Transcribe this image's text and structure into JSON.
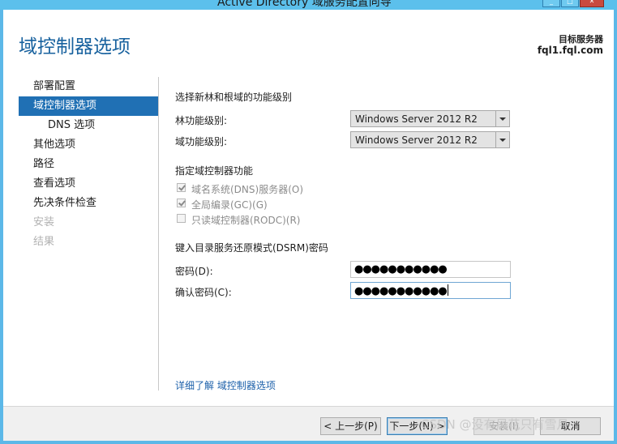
{
  "window": {
    "title": "Active Directory 域服务配置向导",
    "controls": [
      "minimize",
      "maximize",
      "close"
    ]
  },
  "header": {
    "page_title": "域控制器选项",
    "target_label": "目标服务器",
    "target_host": "fql1.fql.com"
  },
  "nav": {
    "items": [
      {
        "label": "部署配置",
        "state": "normal"
      },
      {
        "label": "域控制器选项",
        "state": "active"
      },
      {
        "label": "DNS 选项",
        "state": "sub"
      },
      {
        "label": "其他选项",
        "state": "normal"
      },
      {
        "label": "路径",
        "state": "normal"
      },
      {
        "label": "查看选项",
        "state": "normal"
      },
      {
        "label": "先决条件检查",
        "state": "normal"
      },
      {
        "label": "安装",
        "state": "disabled"
      },
      {
        "label": "结果",
        "state": "disabled"
      }
    ]
  },
  "form": {
    "functional_level_heading": "选择新林和根域的功能级别",
    "forest_level_label": "林功能级别:",
    "forest_level_value": "Windows Server 2012 R2",
    "domain_level_label": "域功能级别:",
    "domain_level_value": "Windows Server 2012 R2",
    "dc_capabilities_heading": "指定域控制器功能",
    "capabilities": [
      {
        "label": "域名系统(DNS)服务器(O)",
        "checked": true
      },
      {
        "label": "全局编录(GC)(G)",
        "checked": true
      },
      {
        "label": "只读域控制器(RODC)(R)",
        "checked": false
      }
    ],
    "dsrm_heading": "键入目录服务还原模式(DSRM)密码",
    "password_label": "密码(D):",
    "password_value": "●●●●●●●●●●●",
    "confirm_label": "确认密码(C):",
    "confirm_value": "●●●●●●●●●●●",
    "more_link": "详细了解 域控制器选项"
  },
  "footer": {
    "prev_label": "< 上一步(P)",
    "next_label": "下一步(N) >",
    "install_label": "安装(I)",
    "cancel_label": "取消"
  },
  "watermark": "CSDN @没有风花只有雪月",
  "colors": {
    "accent": "#2070b4",
    "title_text": "#17619e",
    "window_frame": "#5cb8e8",
    "link": "#1c60aa"
  }
}
